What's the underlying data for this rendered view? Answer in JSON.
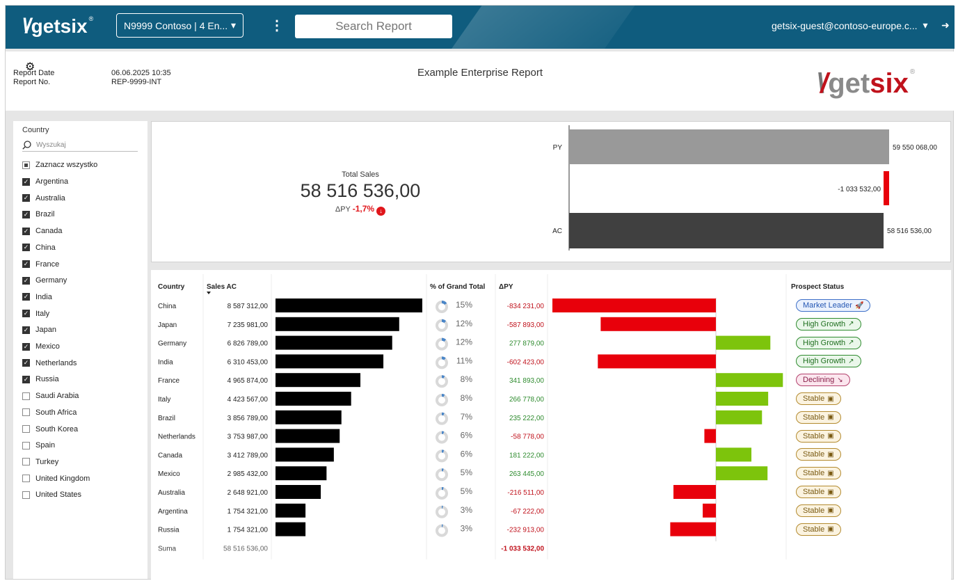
{
  "topbar": {
    "logo": "getsix",
    "logo_mark": "®",
    "workspace": "N9999 Contoso | 4 En...",
    "menu_glyph": "⋮",
    "search_placeholder": "Search Report",
    "user": "getsix-guest@contoso-europe.c...",
    "colors": {
      "bar": "#0f5c7e"
    }
  },
  "header": {
    "report_date_label": "Report Date",
    "report_date_value": "06.06.2025 10:35",
    "report_no_label": "Report No.",
    "report_no_value": "REP-9999-INT",
    "title": "Example Enterprise Report",
    "logo_word1": "get",
    "logo_word2": "six",
    "logo_mark": "®"
  },
  "filter": {
    "title": "Country",
    "search_placeholder": "Wyszukaj",
    "select_all": "Zaznacz wszystko",
    "items": [
      {
        "label": "Argentina",
        "checked": true
      },
      {
        "label": "Australia",
        "checked": true
      },
      {
        "label": "Brazil",
        "checked": true
      },
      {
        "label": "Canada",
        "checked": true
      },
      {
        "label": "China",
        "checked": true
      },
      {
        "label": "France",
        "checked": true
      },
      {
        "label": "Germany",
        "checked": true
      },
      {
        "label": "India",
        "checked": true
      },
      {
        "label": "Italy",
        "checked": true
      },
      {
        "label": "Japan",
        "checked": true
      },
      {
        "label": "Mexico",
        "checked": true
      },
      {
        "label": "Netherlands",
        "checked": true
      },
      {
        "label": "Russia",
        "checked": true
      },
      {
        "label": "Saudi Arabia",
        "checked": false
      },
      {
        "label": "South Africa",
        "checked": false
      },
      {
        "label": "South Korea",
        "checked": false
      },
      {
        "label": "Spain",
        "checked": false
      },
      {
        "label": "Turkey",
        "checked": false
      },
      {
        "label": "United Kingdom",
        "checked": false
      },
      {
        "label": "United States",
        "checked": false
      }
    ]
  },
  "kpi": {
    "label": "Total Sales",
    "value": "58 516 536,00",
    "delta_label": "ΔPY",
    "delta_value": "-1,7%"
  },
  "table": {
    "headers": {
      "country": "Country",
      "sales": "Sales AC",
      "pct": "% of Grand Total",
      "dpy": "ΔPY",
      "status": "Prospect Status"
    },
    "total_label": "Suma",
    "total_sales": "58 516 536,00",
    "total_dpy": "-1 033 532,00",
    "rows": [
      {
        "country": "China",
        "sales": "8 587 312,00",
        "pct": "15%",
        "dpy": "-834 231,00",
        "status": "Market Leader",
        "status_type": "ml"
      },
      {
        "country": "Japan",
        "sales": "7 235 981,00",
        "pct": "12%",
        "dpy": "-587 893,00",
        "status": "High Growth",
        "status_type": "hg"
      },
      {
        "country": "Germany",
        "sales": "6 826 789,00",
        "pct": "12%",
        "dpy": "277 879,00",
        "status": "High Growth",
        "status_type": "hg"
      },
      {
        "country": "India",
        "sales": "6 310 453,00",
        "pct": "11%",
        "dpy": "-602 423,00",
        "status": "High Growth",
        "status_type": "hg"
      },
      {
        "country": "France",
        "sales": "4 965 874,00",
        "pct": "8%",
        "dpy": "341 893,00",
        "status": "Declining",
        "status_type": "dc"
      },
      {
        "country": "Italy",
        "sales": "4 423 567,00",
        "pct": "8%",
        "dpy": "266 778,00",
        "status": "Stable",
        "status_type": "st"
      },
      {
        "country": "Brazil",
        "sales": "3 856 789,00",
        "pct": "7%",
        "dpy": "235 222,00",
        "status": "Stable",
        "status_type": "st"
      },
      {
        "country": "Netherlands",
        "sales": "3 753 987,00",
        "pct": "6%",
        "dpy": "-58 778,00",
        "status": "Stable",
        "status_type": "st"
      },
      {
        "country": "Canada",
        "sales": "3 412 789,00",
        "pct": "6%",
        "dpy": "181 222,00",
        "status": "Stable",
        "status_type": "st"
      },
      {
        "country": "Mexico",
        "sales": "2 985 432,00",
        "pct": "5%",
        "dpy": "263 445,00",
        "status": "Stable",
        "status_type": "st"
      },
      {
        "country": "Australia",
        "sales": "2 648 921,00",
        "pct": "5%",
        "dpy": "-216 511,00",
        "status": "Stable",
        "status_type": "st"
      },
      {
        "country": "Argentina",
        "sales": "1 754 321,00",
        "pct": "3%",
        "dpy": "-67 222,00",
        "status": "Stable",
        "status_type": "st"
      },
      {
        "country": "Russia",
        "sales": "1 754 321,00",
        "pct": "3%",
        "dpy": "-232 913,00",
        "status": "Stable",
        "status_type": "st"
      }
    ]
  },
  "chart_data": [
    {
      "type": "bar",
      "categories": [
        "PY",
        "",
        "AC"
      ],
      "values": [
        59550068,
        -1033532,
        58516536
      ],
      "labels": [
        "59 550 068,00",
        "-1 033 532,00",
        "58 516 536,00"
      ],
      "colors": {
        "PY": "#999999",
        "delta_neg": "#e8000b",
        "AC": "#404040"
      }
    },
    {
      "type": "bar",
      "categories": [
        "China",
        "Japan",
        "Germany",
        "India",
        "France",
        "Italy",
        "Brazil",
        "Netherlands",
        "Canada",
        "Mexico",
        "Australia",
        "Argentina",
        "Russia"
      ],
      "series": [
        {
          "name": "Sales AC",
          "values": [
            8587312,
            7235981,
            6826789,
            6310453,
            4965874,
            4423567,
            3856789,
            3753987,
            3412789,
            2985432,
            2648921,
            1754321,
            1754321
          ]
        },
        {
          "name": "% of Grand Total",
          "values": [
            15,
            12,
            12,
            11,
            8,
            8,
            7,
            6,
            6,
            5,
            5,
            3,
            3
          ]
        },
        {
          "name": "ΔPY",
          "values": [
            -834231,
            -587893,
            277879,
            -602423,
            341893,
            266778,
            235222,
            -58778,
            181222,
            263445,
            -216511,
            -67222,
            -232913
          ]
        }
      ],
      "colors": {
        "bars": "#000000",
        "positive": "#7dc40c",
        "negative": "#e8000b",
        "donut": "#4a86c8"
      }
    }
  ]
}
